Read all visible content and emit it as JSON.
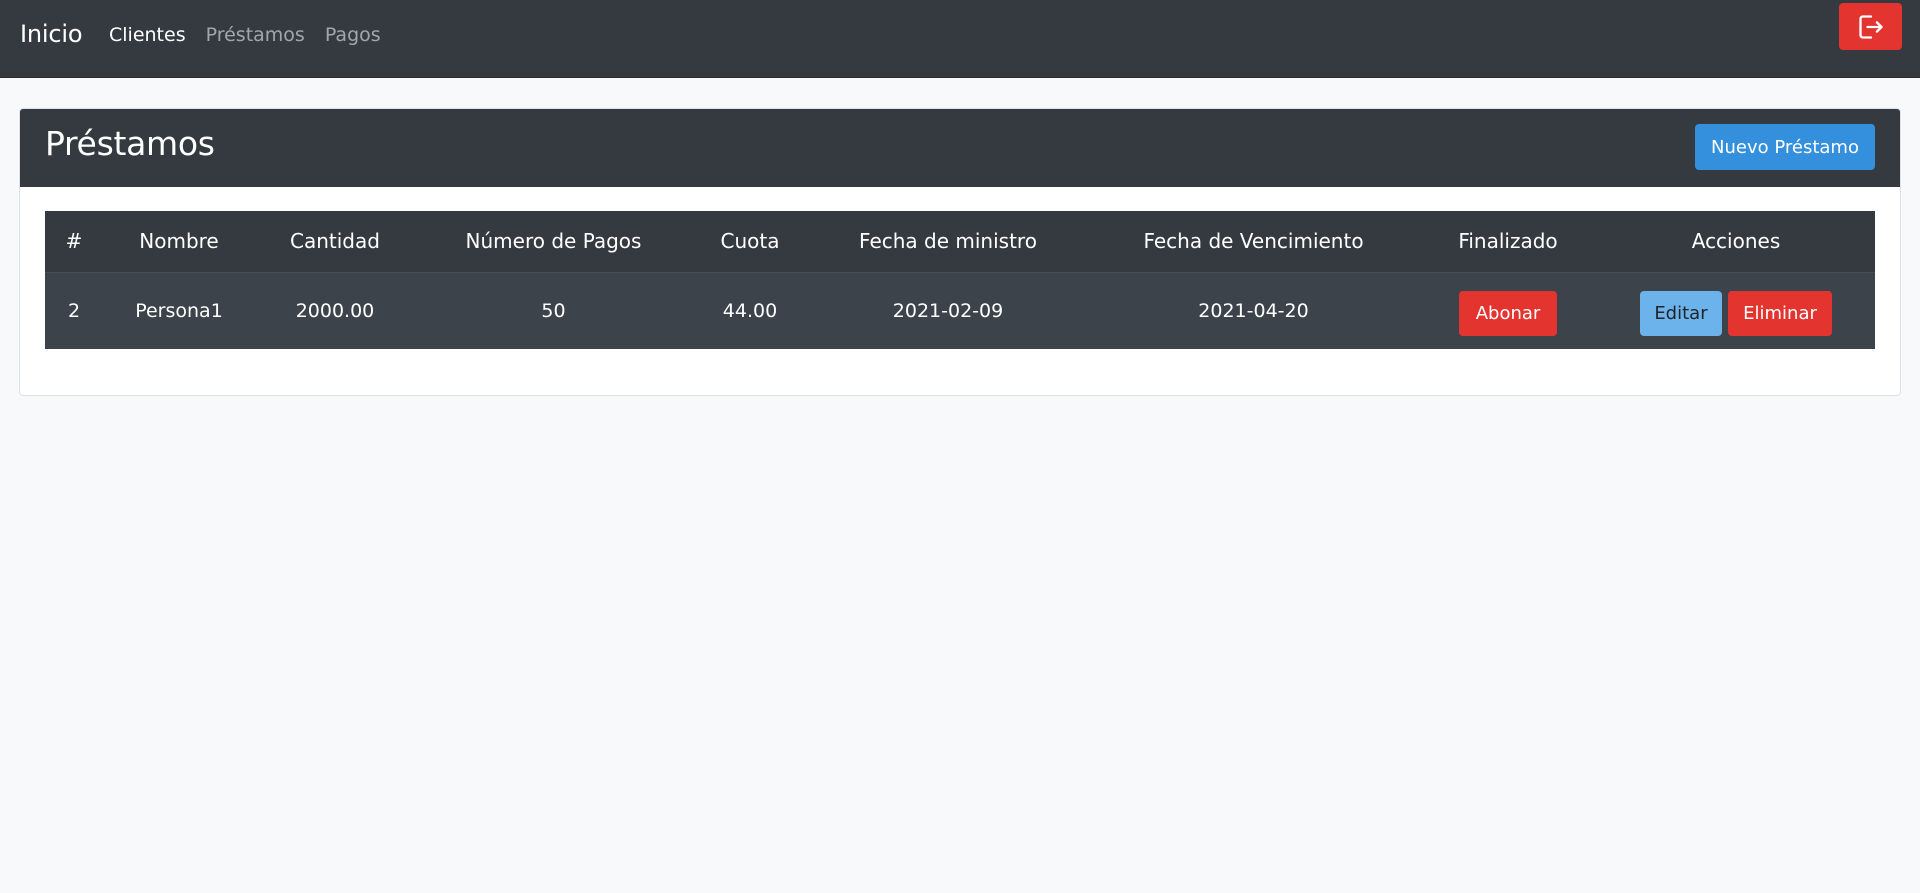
{
  "navbar": {
    "brand": "Inicio",
    "links": [
      {
        "label": "Clientes",
        "active": true
      },
      {
        "label": "Préstamos",
        "active": false
      },
      {
        "label": "Pagos",
        "active": false
      }
    ],
    "logout_icon": "sign-out-icon"
  },
  "card": {
    "title": "Préstamos",
    "new_button": "Nuevo Préstamo"
  },
  "table": {
    "headers": [
      "#",
      "Nombre",
      "Cantidad",
      "Número de Pagos",
      "Cuota",
      "Fecha de ministro",
      "Fecha de Vencimiento",
      "Finalizado",
      "Acciones"
    ],
    "rows": [
      {
        "id": "2",
        "nombre": "Persona1",
        "cantidad": "2000.00",
        "numero_pagos": "50",
        "cuota": "44.00",
        "fecha_ministro": "2021-02-09",
        "fecha_vencimiento": "2021-04-20",
        "finalizado_button": "Abonar",
        "edit_button": "Editar",
        "delete_button": "Eliminar"
      }
    ]
  },
  "colors": {
    "navbar_bg": "#343a40",
    "danger": "#e3342f",
    "primary": "#3490dc",
    "info": "#6cb2eb"
  }
}
